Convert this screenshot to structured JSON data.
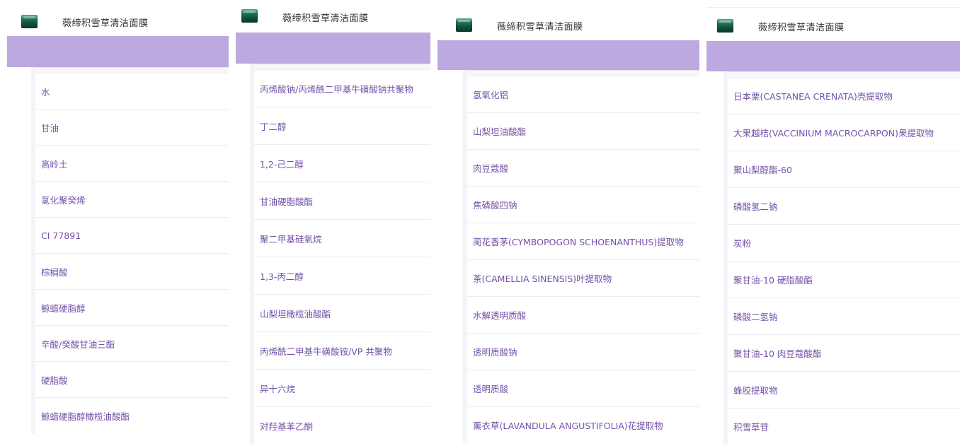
{
  "product_title": "薇缔积雪草清洁面膜",
  "colors": {
    "band": "#bba9e0",
    "ingredient_text": "#7452a8",
    "title_text": "#333333"
  },
  "icons": [
    "product-jar-icon"
  ],
  "panels": [
    {
      "ingredients": [
        "水",
        "甘油",
        "高岭土",
        "氢化聚癸烯",
        "CI 77891",
        "棕榈酸",
        "鲸蜡硬脂醇",
        "辛酸/癸酸甘油三酯",
        "硬脂酸",
        "鲸蜡硬脂醇橄榄油酸酯"
      ]
    },
    {
      "ingredients": [
        "丙烯酸钠/丙烯酰二甲基牛磺酸钠共聚物",
        "丁二醇",
        "1,2-己二醇",
        "甘油硬脂酸酯",
        "聚二甲基硅氧烷",
        "1,3-丙二醇",
        "山梨坦橄榄油酸酯",
        "丙烯酰二甲基牛磺酸铵/VP 共聚物",
        "异十六烷",
        "对羟基苯乙酮"
      ]
    },
    {
      "ingredients": [
        "氢氧化铝",
        "山梨坦油酸酯",
        "肉豆蔻酸",
        "焦磷酸四钠",
        "蔺花香茅(CYMBOPOGON SCHOENANTHUS)提取物",
        "茶(CAMELLIA SINENSIS)叶提取物",
        "水解透明质酸",
        "透明质酸钠",
        "透明质酸",
        "薰衣草(LAVANDULA ANGUSTIFOLIA)花提取物"
      ]
    },
    {
      "ingredients": [
        "日本栗(CASTANEA CRENATA)壳提取物",
        "大果越桔(VACCINIUM MACROCARPON)果提取物",
        "聚山梨醇酯-60",
        "磷酸氢二钠",
        "炭粉",
        "聚甘油-10 硬脂酸酯",
        "磷酸二氢钠",
        "聚甘油-10 肉豆蔻酸酯",
        "蜂胶提取物",
        "积雪草苷"
      ]
    }
  ]
}
